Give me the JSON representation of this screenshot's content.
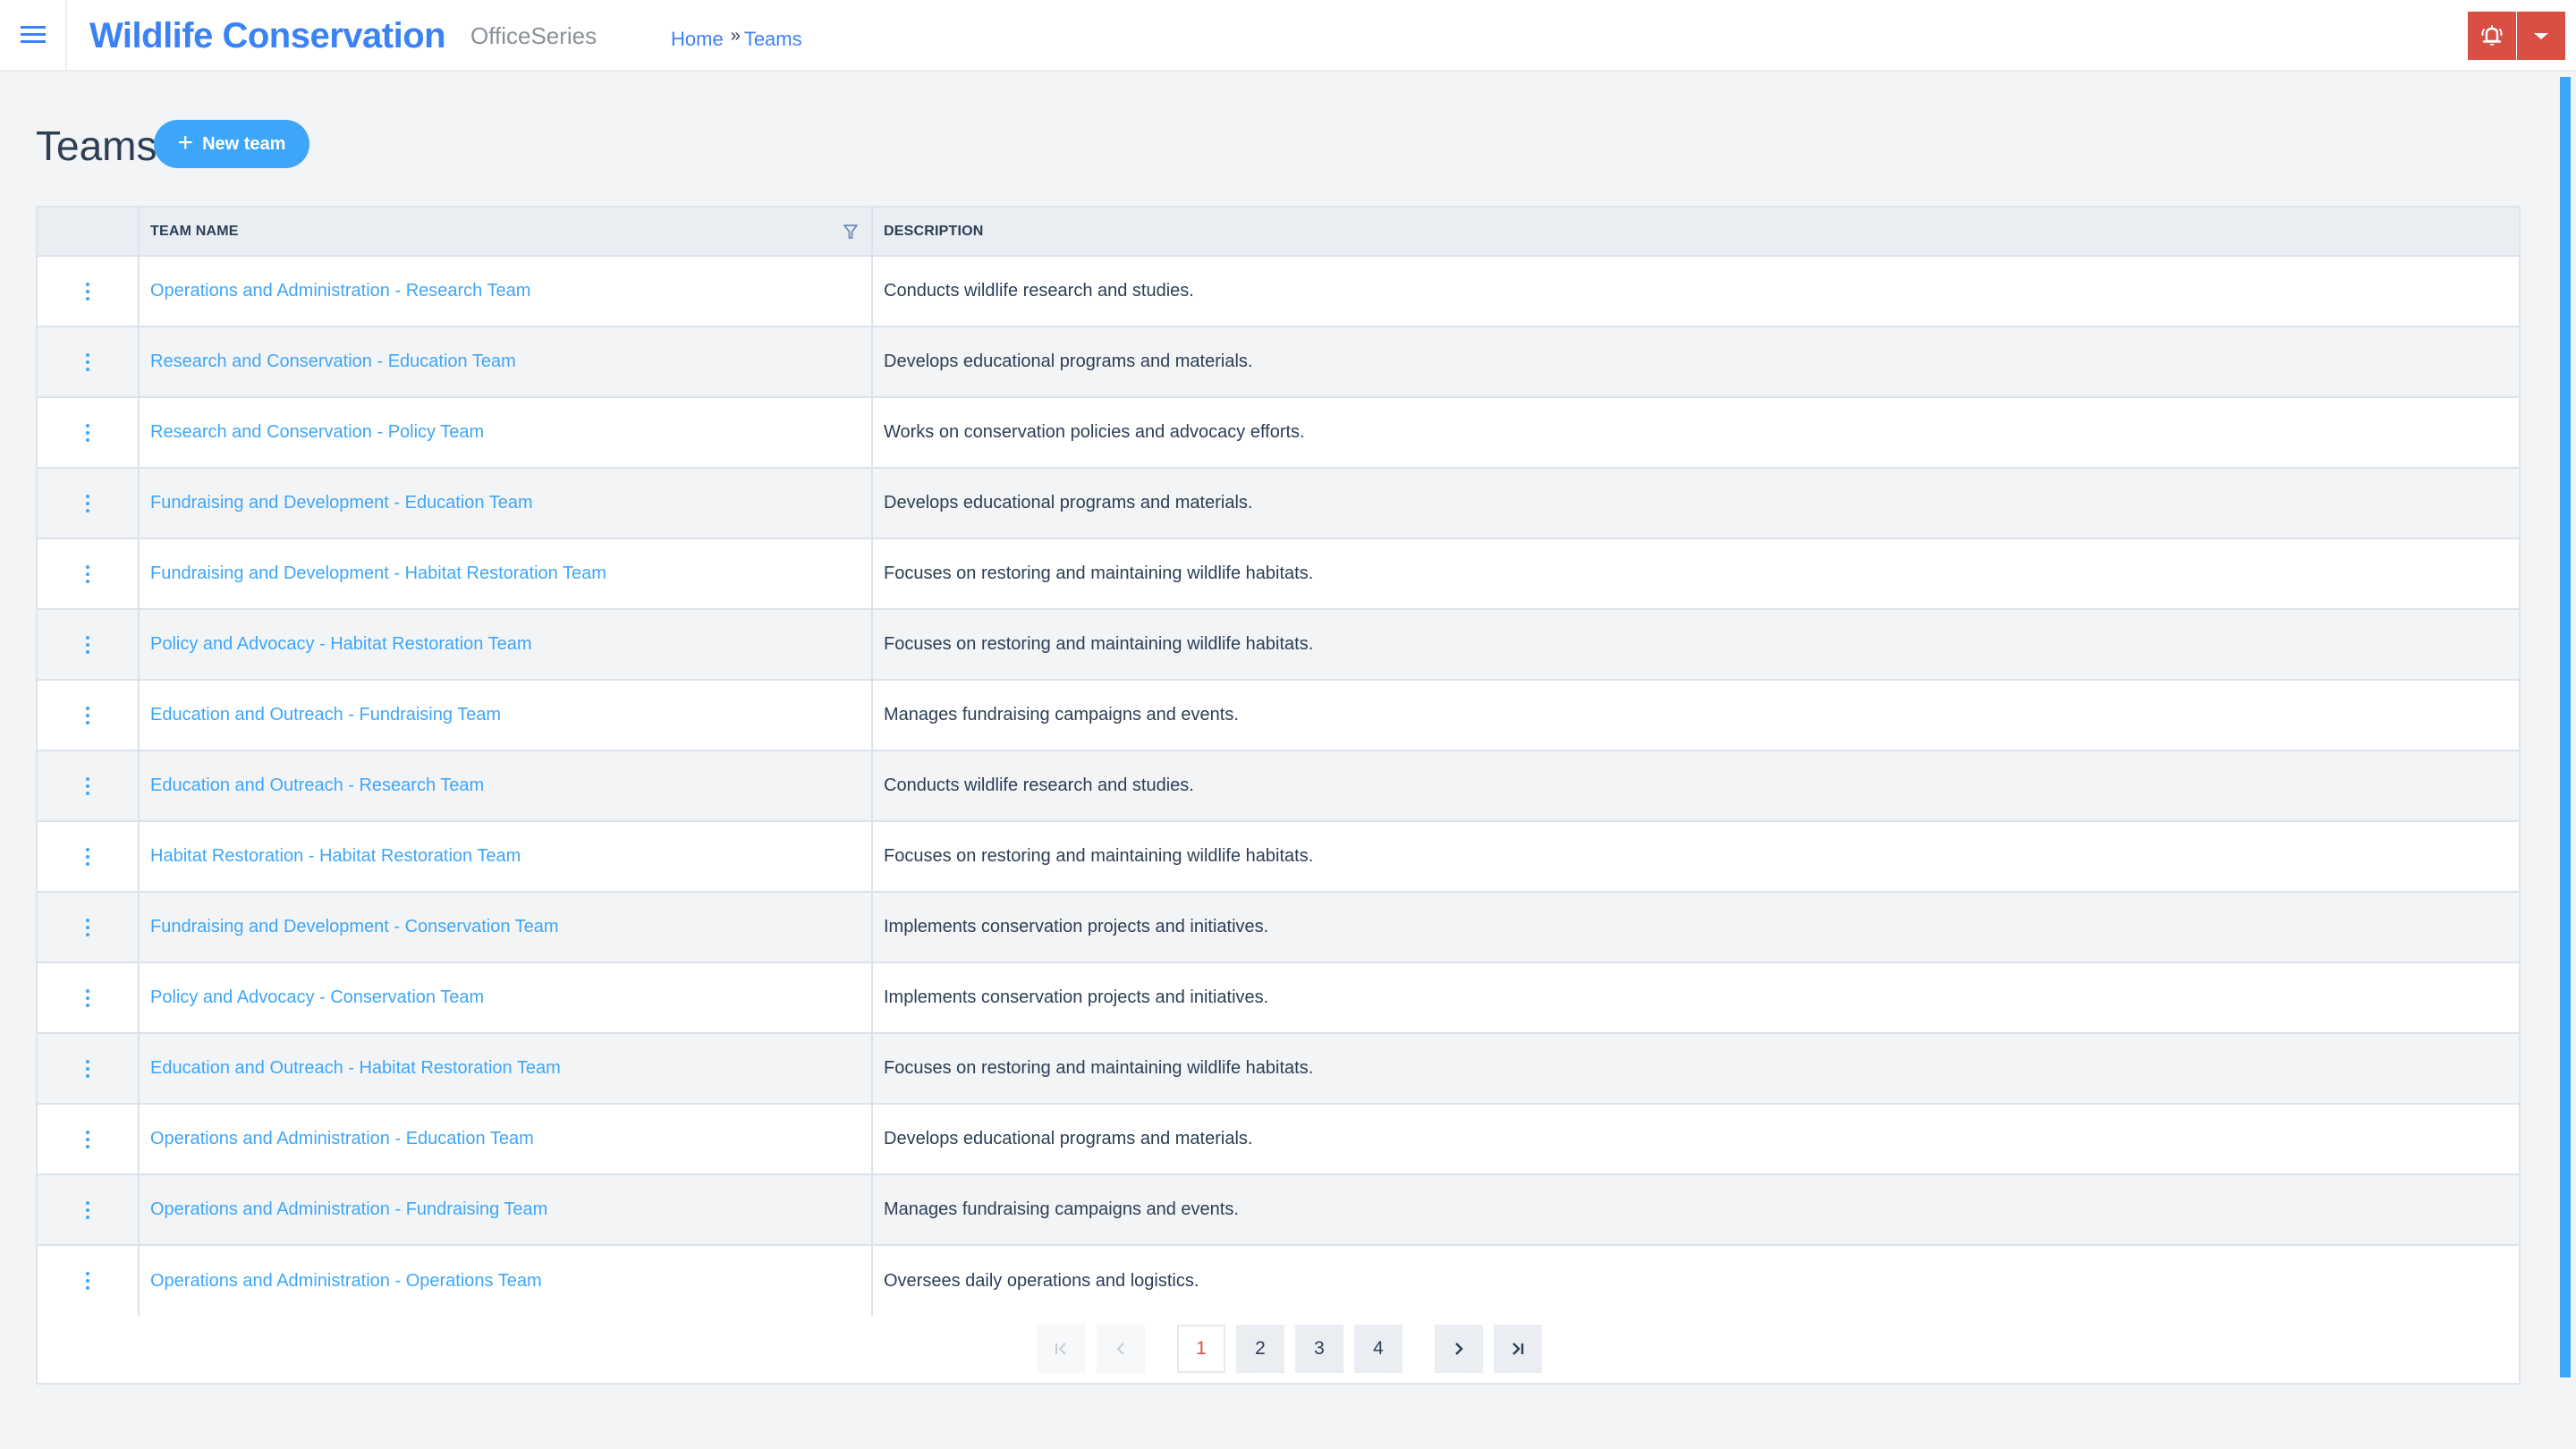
{
  "header": {
    "app_title": "Wildlife Conservation",
    "app_subtitle": "OfficeSeries",
    "breadcrumb": [
      {
        "label": "Home"
      },
      {
        "label": "Teams"
      }
    ],
    "breadcrumb_separator": "»",
    "notification_color": "#d94f43"
  },
  "page": {
    "title": "Teams",
    "new_button_label": "New team",
    "new_button_icon": "+"
  },
  "table": {
    "columns": [
      {
        "label": ""
      },
      {
        "label": "TEAM NAME",
        "filterable": true
      },
      {
        "label": "DESCRIPTION"
      }
    ],
    "rows": [
      {
        "name": "Operations and Administration - Research Team",
        "description": "Conducts wildlife research and studies."
      },
      {
        "name": "Research and Conservation - Education Team",
        "description": "Develops educational programs and materials."
      },
      {
        "name": "Research and Conservation - Policy Team",
        "description": "Works on conservation policies and advocacy efforts."
      },
      {
        "name": "Fundraising and Development - Education Team",
        "description": "Develops educational programs and materials."
      },
      {
        "name": "Fundraising and Development - Habitat Restoration Team",
        "description": "Focuses on restoring and maintaining wildlife habitats."
      },
      {
        "name": "Policy and Advocacy - Habitat Restoration Team",
        "description": "Focuses on restoring and maintaining wildlife habitats."
      },
      {
        "name": "Education and Outreach - Fundraising Team",
        "description": "Manages fundraising campaigns and events."
      },
      {
        "name": "Education and Outreach - Research Team",
        "description": "Conducts wildlife research and studies."
      },
      {
        "name": "Habitat Restoration - Habitat Restoration Team",
        "description": "Focuses on restoring and maintaining wildlife habitats."
      },
      {
        "name": "Fundraising and Development - Conservation Team",
        "description": "Implements conservation projects and initiatives."
      },
      {
        "name": "Policy and Advocacy - Conservation Team",
        "description": "Implements conservation projects and initiatives."
      },
      {
        "name": "Education and Outreach - Habitat Restoration Team",
        "description": "Focuses on restoring and maintaining wildlife habitats."
      },
      {
        "name": "Operations and Administration - Education Team",
        "description": "Develops educational programs and materials."
      },
      {
        "name": "Operations and Administration - Fundraising Team",
        "description": "Manages fundraising campaigns and events."
      },
      {
        "name": "Operations and Administration - Operations Team",
        "description": "Oversees daily operations and logistics."
      }
    ]
  },
  "pagination": {
    "current_page": 1,
    "pages": [
      "1",
      "2",
      "3",
      "4"
    ],
    "first_icon": "first-page",
    "prev_icon": "previous-page",
    "next_icon": "next-page",
    "last_icon": "last-page"
  },
  "colors": {
    "accent": "#3b82f6",
    "link": "#3ea6f8",
    "danger": "#d94f43",
    "text": "#2d3e55"
  }
}
